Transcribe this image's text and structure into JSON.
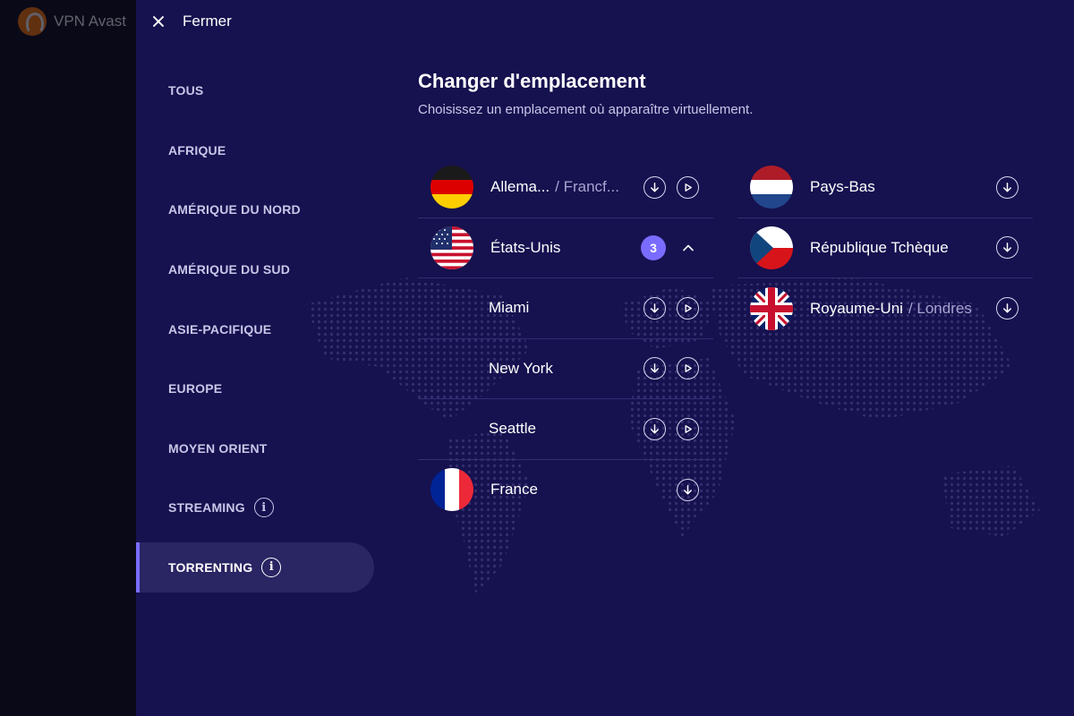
{
  "app": {
    "name": "VPN Avast"
  },
  "header": {
    "close_label": "Fermer"
  },
  "sidebar": {
    "items": [
      {
        "label": "TOUS"
      },
      {
        "label": "AFRIQUE"
      },
      {
        "label": "AMÉRIQUE DU NORD"
      },
      {
        "label": "AMÉRIQUE DU SUD"
      },
      {
        "label": "ASIE-PACIFIQUE"
      },
      {
        "label": "EUROPE"
      },
      {
        "label": "MOYEN ORIENT"
      },
      {
        "label": "STREAMING",
        "info": "i"
      },
      {
        "label": "TORRENTING",
        "info": "i",
        "active": true
      }
    ]
  },
  "main": {
    "title": "Changer d'emplacement",
    "subtitle": "Choisissez un emplacement où apparaître virtuellement."
  },
  "locations": {
    "left": [
      {
        "country": "Allema...",
        "city": "/ Francf...",
        "flag": "germany"
      },
      {
        "country": "États-Unis",
        "flag": "usa",
        "count": "3",
        "expanded": true,
        "cities": [
          {
            "name": "Miami"
          },
          {
            "name": "New York"
          },
          {
            "name": "Seattle"
          }
        ]
      },
      {
        "country": "France",
        "flag": "france"
      }
    ],
    "right": [
      {
        "country": "Pays-Bas",
        "flag": "netherlands"
      },
      {
        "country": "République Tchèque",
        "flag": "czech"
      },
      {
        "country": "Royaume-Uni",
        "city": "/ Londres",
        "flag": "uk"
      }
    ]
  },
  "icons": {
    "close": "close-icon",
    "download": "download-icon",
    "play": "play-icon",
    "chevron": "chevron-up-icon",
    "info": "info-icon"
  },
  "colors": {
    "panel_bg": "#16114f",
    "accent": "#7a6cff",
    "side_bg": "#0a0918"
  }
}
